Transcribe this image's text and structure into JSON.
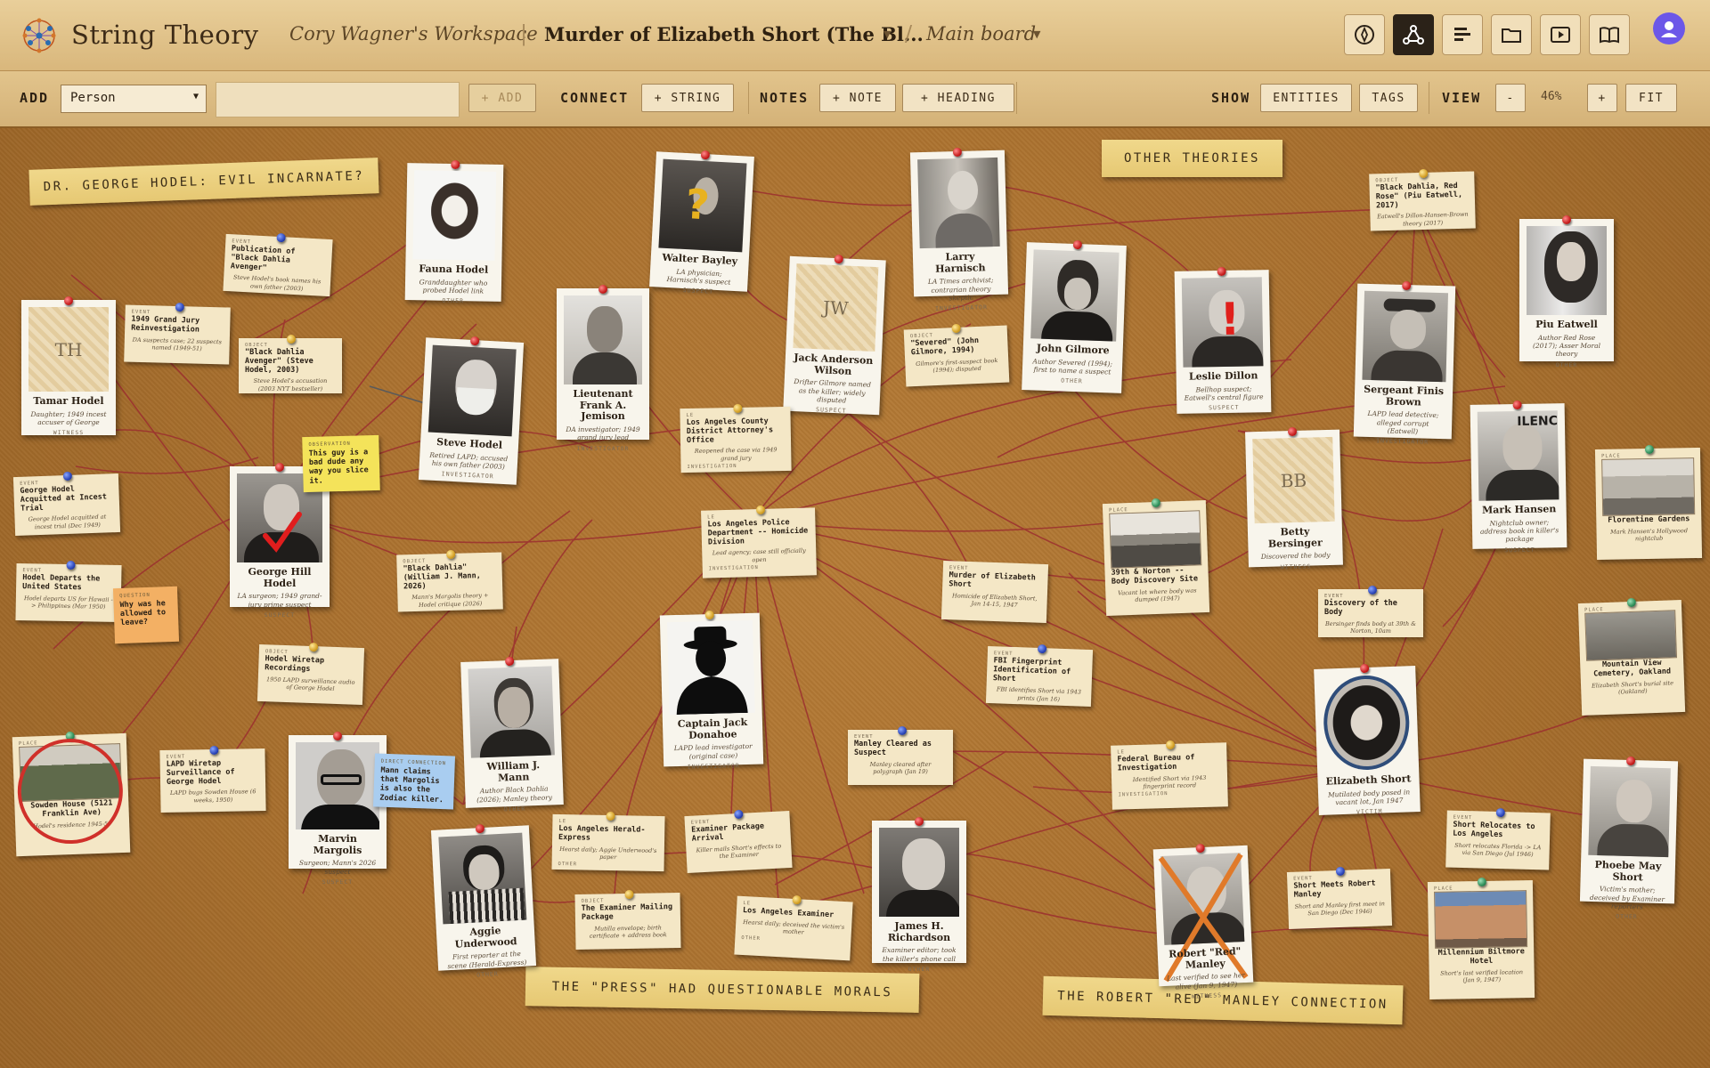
{
  "app": {
    "title": "String Theory"
  },
  "breadcrumb": {
    "workspace": "Cory Wagner's Workspace",
    "case": "Murder of Elizabeth Short (The Bl...",
    "board": "Main board"
  },
  "nav": [
    {
      "name": "compass-icon"
    },
    {
      "name": "graph-icon"
    },
    {
      "name": "timeline-icon"
    },
    {
      "name": "folder-icon"
    },
    {
      "name": "play-icon"
    },
    {
      "name": "book-icon"
    }
  ],
  "toolbar": {
    "add_label": "ADD",
    "type_selected": "Person",
    "add_button": "+ ADD",
    "connect_label": "CONNECT",
    "string_button": "+ STRING",
    "notes_label": "NOTES",
    "note_button": "+ NOTE",
    "heading_button": "+ HEADING",
    "show_label": "SHOW",
    "entities_button": "ENTITIES",
    "tags_button": "TAGS",
    "view_label": "VIEW",
    "zoom_out": "-",
    "zoom_level": "46%",
    "zoom_in": "+",
    "fit_button": "FIT"
  },
  "headings": {
    "hodel": "DR. GEORGE HODEL: EVIL INCARNATE?",
    "other": "OTHER THEORIES",
    "press": "THE \"PRESS\" HAD QUESTIONABLE MORALS",
    "manley": "THE ROBERT \"RED\" MANLEY CONNECTION"
  },
  "people": {
    "tamar": {
      "initials": "TH",
      "name": "Tamar Hodel",
      "desc": "Daughter; 1949 incest accuser of George",
      "role": "WITNESS"
    },
    "fauna": {
      "name": "Fauna Hodel",
      "desc": "Granddaughter who probed Hodel link",
      "role": "OTHER"
    },
    "walter": {
      "name": "Walter Bayley",
      "desc": "LA physician; Harnisch's suspect",
      "role": "SUSPECT"
    },
    "larry": {
      "name": "Larry Harnisch",
      "desc": "LA Times archivist; contrarian theory skeptic",
      "role": "INVESTIGATOR"
    },
    "jamison": {
      "name": "Lieutenant Frank A. Jemison",
      "desc": "DA investigator; 1949 grand jury lead",
      "role": "INVESTIGATOR"
    },
    "jack_wilson": {
      "initials": "JW",
      "name": "Jack Anderson Wilson",
      "desc": "Drifter Gilmore named as the killer; widely disputed",
      "role": "SUSPECT"
    },
    "gilmore": {
      "name": "John Gilmore",
      "desc": "Author Severed (1994); first to name a suspect",
      "role": "OTHER"
    },
    "dillon": {
      "name": "Leslie Dillon",
      "desc": "Bellhop suspect; Eatwell's central figure",
      "role": "SUSPECT"
    },
    "finis": {
      "name": "Sergeant Finis Brown",
      "desc": "LAPD lead detective; alleged corrupt (Eatwell)",
      "role": "INVESTIGATOR"
    },
    "piu": {
      "name": "Piu Eatwell",
      "desc": "Author Red Rose (2017); Asser Moral theory",
      "role": "OTHER"
    },
    "steve": {
      "name": "Steve Hodel",
      "desc": "Retired LAPD; accused his own father (2003)",
      "role": "INVESTIGATOR"
    },
    "george": {
      "name": "George Hill Hodel",
      "desc": "LA surgeon; 1949 grand-jury prime suspect",
      "role": "SUSPECT"
    },
    "mark": {
      "name": "Mark Hansen",
      "desc": "Nightclub owner; address book in killer's package",
      "role": "SUSPECT"
    },
    "betty": {
      "initials": "BB",
      "name": "Betty Bersinger",
      "desc": "Discovered the body",
      "role": "WITNESS"
    },
    "donahoe": {
      "name": "Captain Jack Donahoe",
      "desc": "LAPD lead investigator (original case)",
      "role": "INVESTIGATOR"
    },
    "mann": {
      "name": "William J. Mann",
      "desc": "Author Black Dahlia (2026); Manley theory",
      "role": "OTHER"
    },
    "margolis": {
      "name": "Marvin Margolis",
      "desc": "Surgeon; Mann's 2026 suspect",
      "role": "SUSPECT"
    },
    "aggie": {
      "name": "Aggie Underwood",
      "desc": "First reporter at the scene (Herald-Express)",
      "role": "OTHER"
    },
    "richardson": {
      "name": "James H. Richardson",
      "desc": "Examiner editor; took the killer's phone call",
      "role": "OTHER"
    },
    "elizabeth": {
      "name": "Elizabeth Short",
      "desc": "Mutilated body posed in vacant lot, Jan 1947",
      "role": "VICTIM"
    },
    "manley": {
      "name": "Robert \"Red\" Manley",
      "desc": "Last verified to see her alive (Jan 9, 1947)",
      "role": "WITNESS"
    },
    "phoebe": {
      "name": "Phoebe May Short",
      "desc": "Victim's mother; deceived by Examiner reporters",
      "role": "OTHER"
    }
  },
  "places": {
    "norton": {
      "kind": "PLACE",
      "name": "39th & Norton -- Body Discovery Site",
      "desc": "Vacant lot where body was dumped (1947)"
    },
    "florentine": {
      "kind": "PLACE",
      "name": "Florentine Gardens",
      "desc": "Mark Hansen's Hollywood nightclub"
    },
    "mountain": {
      "kind": "PLACE",
      "name": "Mountain View Cemetery, Oakland",
      "desc": "Elizabeth Short's burial site (Oakland)"
    },
    "sowden": {
      "kind": "PLACE",
      "name": "Sowden House (5121 Franklin Ave)",
      "desc": "Hodel's residence 1945-50"
    },
    "biltmore": {
      "kind": "PLACE",
      "name": "Millennium Biltmore Hotel",
      "desc": "Short's last verified location (Jan 9, 1947)"
    }
  },
  "notes": {
    "publication": {
      "kind": "EVENT",
      "title": "Publication of \"Black Dahlia Avenger\"",
      "body": "Steve Hodel's book names his own father (2003)"
    },
    "grandjury": {
      "kind": "EVENT",
      "title": "1949 Grand Jury Reinvestigation",
      "body": "DA suspects case; 22 suspects named (1949-51)"
    },
    "avenger": {
      "kind": "OBJECT",
      "title": "\"Black Dahlia Avenger\" (Steve Hodel, 2003)",
      "body": "Steve Hodel's accusation (2003 NYT bestseller)"
    },
    "acquitted": {
      "kind": "EVENT",
      "title": "George Hodel Acquitted at Incest Trial",
      "body": "George Hodel acquitted at incest trial (Dec 1949)"
    },
    "departs": {
      "kind": "EVENT",
      "title": "Hodel Departs the United States",
      "body": "Hodel departs US for Hawaii -> Philippines (Mar 1950)"
    },
    "blackdahlia_mann": {
      "kind": "OBJECT",
      "title": "\"Black Dahlia\" (William J. Mann, 2026)",
      "body": "Mann's Margolis theory + Hodel critique (2026)"
    },
    "wiretap_rec": {
      "kind": "OBJECT",
      "title": "Hodel Wiretap Recordings",
      "body": "1950 LAPD surveillance audio of George Hodel"
    },
    "surveillance": {
      "kind": "EVENT",
      "title": "LAPD Wiretap Surveillance of George Hodel",
      "body": "LAPD bugs Sowden House (6 weeks, 1950)"
    },
    "severed": {
      "kind": "OBJECT",
      "title": "\"Severed\" (John Gilmore, 1994)",
      "body": "Gilmore's first-suspect book (1994); disputed"
    },
    "da_office": {
      "kind": "LE",
      "title": "Los Angeles County District Attorney's Office",
      "body": "Reopened the case via 1949 grand jury",
      "role": "INVESTIGATION"
    },
    "lapd": {
      "kind": "LE",
      "title": "Los Angeles Police Department -- Homicide Division",
      "body": "Lead agency; case still officially open",
      "role": "INVESTIGATION"
    },
    "murder": {
      "kind": "EVENT",
      "title": "Murder of Elizabeth Short",
      "body": "Homicide of Elizabeth Short, Jan 14-15, 1947"
    },
    "discovery": {
      "kind": "EVENT",
      "title": "Discovery of the Body",
      "body": "Bersinger finds body at 39th & Norton, 10am"
    },
    "fbi": {
      "kind": "EVENT",
      "title": "FBI Fingerprint Identification of Short",
      "body": "FBI identifies Short via 1943 prints (Jan 16)"
    },
    "fbi_bureau": {
      "kind": "LE",
      "title": "Federal Bureau of Investigation",
      "body": "Identified Short via 1943 fingerprint record",
      "role": "INVESTIGATION"
    },
    "black_dahlia_theory": {
      "kind": "OBJECT",
      "title": "\"Black Dahlia, Red Rose\" (Piu Eatwell, 2017)",
      "body": "Eatwell's Dillon-Hansen-Brown theory (2017)"
    },
    "manley_cleared": {
      "kind": "EVENT",
      "title": "Manley Cleared as Suspect",
      "body": "Manley cleared after polygraph (Jan 19)"
    },
    "herald": {
      "kind": "LE",
      "title": "Los Angeles Herald-Express",
      "body": "Hearst daily; Aggie Underwood's paper",
      "role": "OTHER"
    },
    "examiner_pkg": {
      "kind": "EVENT",
      "title": "Examiner Package Arrival",
      "body": "Killer mails Short's effects to the Examiner"
    },
    "mailing_pkg": {
      "kind": "OBJECT",
      "title": "The Examiner Mailing Package",
      "body": "Mutilla envelope; birth certificate + address book"
    },
    "examiner": {
      "kind": "LE",
      "title": "Los Angeles Examiner",
      "body": "Hearst daily; deceived the victim's mother",
      "role": "OTHER"
    },
    "relocates": {
      "kind": "EVENT",
      "title": "Short Relocates to Los Angeles",
      "body": "Short relocates Florida -> LA via San Diego (Jul 1946)"
    },
    "meets": {
      "kind": "EVENT",
      "title": "Short Meets Robert Manley",
      "body": "Short and Manley first meet in San Diego (Dec 1946)"
    }
  },
  "stickies": {
    "bad_dude": {
      "kind": "OBSERVATION",
      "text": "This guy is a bad dude any way you slice it."
    },
    "question": {
      "kind": "QUESTION",
      "text": "Why was he allowed to leave?"
    },
    "margolis_claim": {
      "kind": "DIRECT CONNECTION",
      "text": "Mann claims that Margolis is also the Zodiac killer."
    }
  },
  "colors": {
    "board": "#aa7230",
    "string": "#9c2f2f",
    "heading": "#ecd183",
    "card": "#f8f5ec",
    "note": "#f4e7c6",
    "sticky_yellow": "#f4e35a",
    "sticky_orange": "#f3b064",
    "sticky_blue": "#a9cdf0",
    "accent_dark": "#2b2218"
  }
}
